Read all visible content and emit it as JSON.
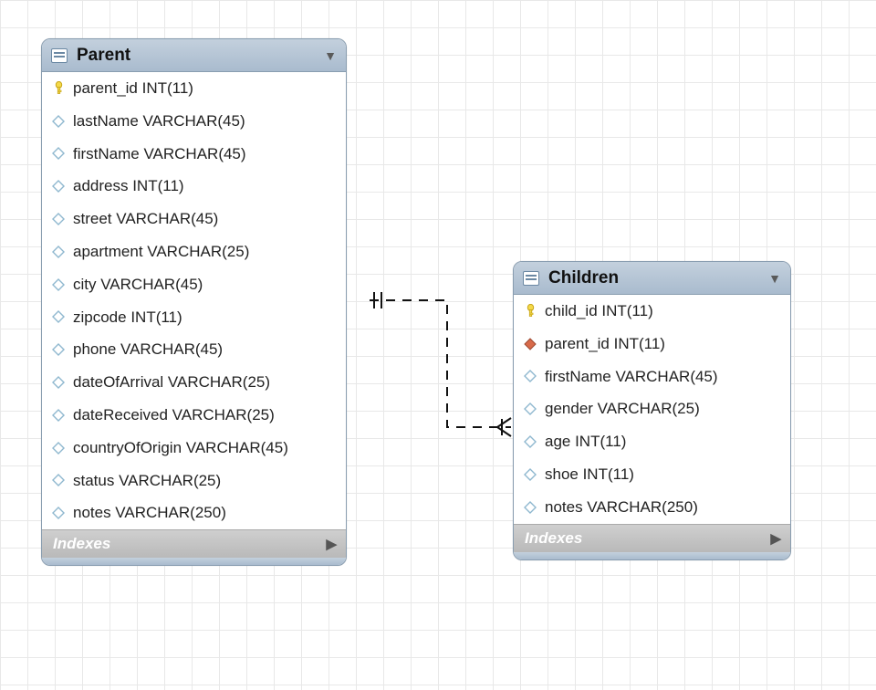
{
  "indexesLabel": "Indexes",
  "tables": {
    "parent": {
      "title": "Parent",
      "columns": [
        {
          "icon": "pk",
          "text": "parent_id INT(11)"
        },
        {
          "icon": "field",
          "text": "lastName VARCHAR(45)"
        },
        {
          "icon": "field",
          "text": "firstName VARCHAR(45)"
        },
        {
          "icon": "field",
          "text": "address INT(11)"
        },
        {
          "icon": "field",
          "text": "street VARCHAR(45)"
        },
        {
          "icon": "field",
          "text": "apartment VARCHAR(25)"
        },
        {
          "icon": "field",
          "text": "city VARCHAR(45)"
        },
        {
          "icon": "field",
          "text": "zipcode INT(11)"
        },
        {
          "icon": "field",
          "text": "phone VARCHAR(45)"
        },
        {
          "icon": "field",
          "text": "dateOfArrival VARCHAR(25)"
        },
        {
          "icon": "field",
          "text": "dateReceived VARCHAR(25)"
        },
        {
          "icon": "field",
          "text": "countryOfOrigin VARCHAR(45)"
        },
        {
          "icon": "field",
          "text": "status VARCHAR(25)"
        },
        {
          "icon": "field",
          "text": "notes VARCHAR(250)"
        }
      ]
    },
    "children": {
      "title": "Children",
      "columns": [
        {
          "icon": "pk",
          "text": "child_id INT(11)"
        },
        {
          "icon": "fk",
          "text": "parent_id INT(11)"
        },
        {
          "icon": "field",
          "text": "firstName VARCHAR(45)"
        },
        {
          "icon": "field",
          "text": "gender VARCHAR(25)"
        },
        {
          "icon": "field",
          "text": "age INT(11)"
        },
        {
          "icon": "field",
          "text": "shoe INT(11)"
        },
        {
          "icon": "field",
          "text": "notes VARCHAR(250)"
        }
      ]
    }
  }
}
